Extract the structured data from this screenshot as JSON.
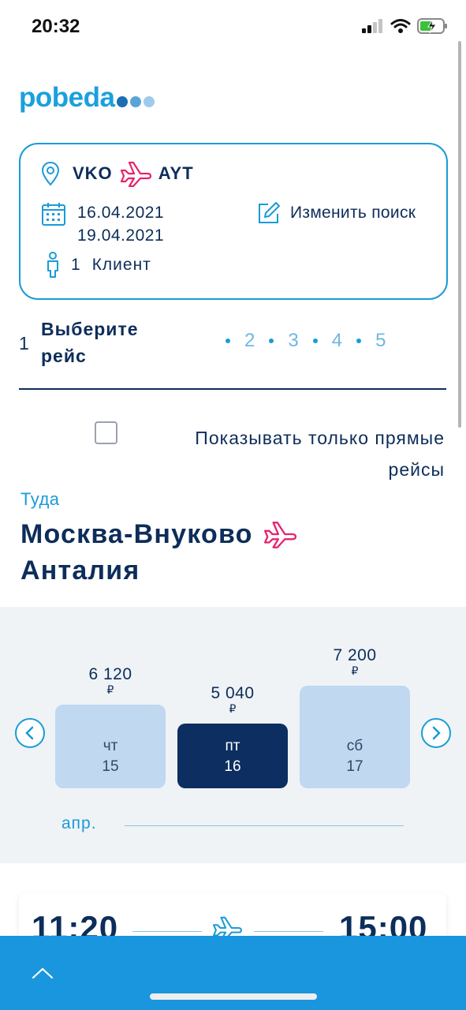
{
  "status_bar": {
    "time": "20:32"
  },
  "logo": {
    "text": "pobeda",
    "dot_colors": [
      "#1a6fb0",
      "#5aa4d8",
      "#9ecbea"
    ]
  },
  "search_card": {
    "from": "VKO",
    "to": "AYT",
    "date_out": "16.04.2021",
    "date_back": "19.04.2021",
    "change_label": "Изменить поиск",
    "client_count": "1",
    "client_label": "Клиент"
  },
  "steps": {
    "current_number": "1",
    "current_title_line1": "Выберите",
    "current_title_line2": "рейс",
    "others": [
      "2",
      "3",
      "4",
      "5"
    ]
  },
  "filter": {
    "direct_label_line1": "Показывать только прямые",
    "direct_label_line2": "рейсы",
    "direct_checked": false
  },
  "direction": {
    "caption": "Туда",
    "from_city": "Москва-Внуково",
    "to_city": "Анталия"
  },
  "calendar": {
    "days": [
      {
        "price": "6 120",
        "currency": "₽",
        "weekday": "чт",
        "day": "15",
        "selected": false
      },
      {
        "price": "5 040",
        "currency": "₽",
        "weekday": "пт",
        "day": "16",
        "selected": true
      },
      {
        "price": "7 200",
        "currency": "₽",
        "weekday": "сб",
        "day": "17",
        "selected": false
      }
    ],
    "month": "апр."
  },
  "flight": {
    "depart_time": "11:20",
    "arrive_time": "15:00"
  },
  "colors": {
    "accent": "#1a9bd8",
    "navy": "#0d2d5a",
    "pink": "#e8226e",
    "selected_day": "#0c2e60",
    "bottom_bar": "#1a96de"
  },
  "icons": [
    "signal-icon",
    "wifi-icon",
    "battery-charging-icon",
    "location-pin-icon",
    "plane-icon",
    "calendar-icon",
    "edit-icon",
    "person-icon",
    "chevron-left-icon",
    "chevron-right-icon",
    "chevron-up-icon"
  ]
}
